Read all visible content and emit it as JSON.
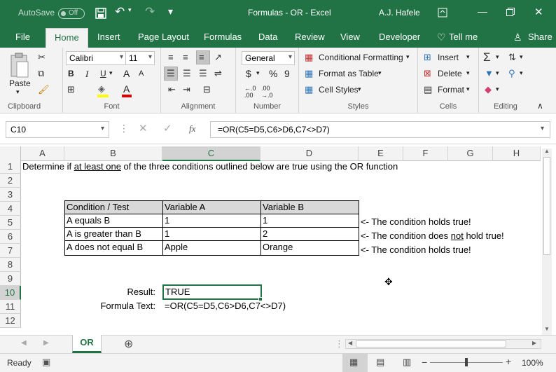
{
  "title_bar": {
    "autosave_label": "AutoSave",
    "autosave_state": "Off",
    "document_title": "Formulas - OR  -  Excel",
    "user_name": "A.J. Hafele"
  },
  "tabs": [
    "File",
    "Home",
    "Insert",
    "Page Layout",
    "Formulas",
    "Data",
    "Review",
    "View",
    "Developer",
    "Tell me",
    "Share"
  ],
  "active_tab": "Home",
  "ribbon": {
    "clipboard": {
      "paste": "Paste",
      "label": "Clipboard"
    },
    "font": {
      "name": "Calibri",
      "size": "11",
      "bold": "B",
      "italic": "I",
      "underline": "U",
      "grow": "A",
      "shrink": "A",
      "color_letter": "A",
      "label": "Font"
    },
    "alignment": {
      "label": "Alignment"
    },
    "number": {
      "format": "General",
      "currency": "$",
      "percent": "%",
      "comma": "9",
      "label": "Number"
    },
    "styles": {
      "conditional": "Conditional Formatting",
      "table": "Format as Table",
      "cell_styles": "Cell Styles",
      "label": "Styles"
    },
    "cells": {
      "insert": "Insert",
      "delete": "Delete",
      "format": "Format",
      "label": "Cells"
    },
    "editing": {
      "label": "Editing"
    }
  },
  "formula_bar": {
    "name_box": "C10",
    "formula": "=OR(C5=D5,C6>D6,C7<>D7)",
    "fx": "fx"
  },
  "columns": [
    "A",
    "B",
    "C",
    "D",
    "E",
    "F",
    "G",
    "H"
  ],
  "rows": [
    "1",
    "2",
    "3",
    "4",
    "5",
    "6",
    "7",
    "8",
    "9",
    "10",
    "11",
    "12"
  ],
  "cells": {
    "a1_pre": "Determine if ",
    "a1_underlined": "at least one",
    "a1_post": " of the three conditions outlined below are true using the OR function",
    "table": {
      "headers": [
        "Condition / Test",
        "Variable A",
        "Variable B"
      ],
      "rows": [
        [
          "A equals B",
          "1",
          "1"
        ],
        [
          "A is greater than B",
          "1",
          "2"
        ],
        [
          "A does not equal B",
          "Apple",
          "Orange"
        ]
      ]
    },
    "e5": "<- The condition holds true!",
    "e6_pre": "<- The condition does ",
    "e6_underlined": "not",
    "e6_post": " hold true!",
    "e7": "<- The condition holds true!",
    "b10": "Result:",
    "c10": "TRUE",
    "b11": "Formula Text:",
    "c11": "=OR(C5=D5,C6>D6,C7<>D7)"
  },
  "sheet_tab": "OR",
  "status": {
    "ready": "Ready",
    "zoom": "100%"
  }
}
